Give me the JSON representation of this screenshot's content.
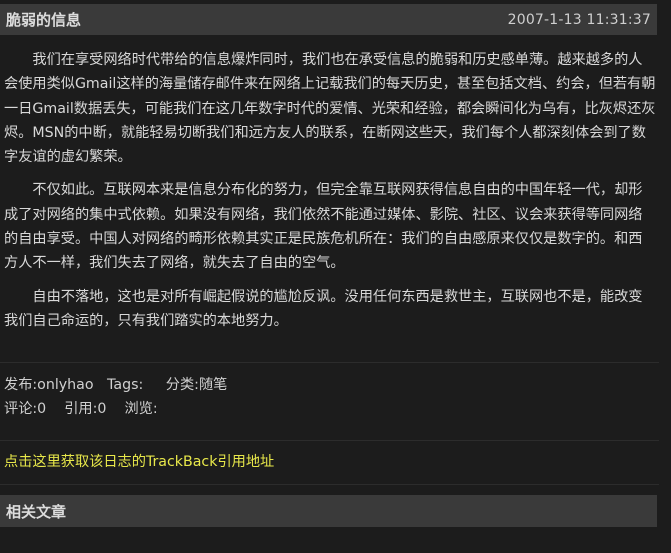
{
  "post": {
    "title": "脆弱的信息",
    "date": "2007-1-13 11:31:37",
    "paragraphs": [
      "　　我们在享受网络时代带给的信息爆炸同时，我们也在承受信息的脆弱和历史感单薄。越来越多的人会使用类似Gmail这样的海量储存邮件来在网络上记载我们的每天历史，甚至包括文档、约会，但若有朝一日Gmail数据丢失，可能我们在这几年数字时代的爱情、光荣和经验，都会瞬间化为乌有，比灰烬还灰烬。MSN的中断，就能轻易切断我们和远方友人的联系，在断网这些天，我们每个人都深刻体会到了数字友谊的虚幻繁荣。",
      "　　不仅如此。互联网本来是信息分布化的努力，但完全靠互联网获得信息自由的中国年轻一代，却形成了对网络的集中式依赖。如果没有网络，我们依然不能通过媒体、影院、社区、议会来获得等同网络的自由享受。中国人对网络的畸形依赖其实正是民族危机所在：我们的自由感原来仅仅是数字的。和西方人不一样，我们失去了网络，就失去了自由的空气。",
      "　　自由不落地，这也是对所有崛起假说的尴尬反讽。没用任何东西是救世主，互联网也不是，能改变我们自己命运的，只有我们踏实的本地努力。"
    ]
  },
  "meta": {
    "line1": "发布:onlyhao   Tags:     分类:随笔",
    "line2": "评论:0    引用:0    浏览:"
  },
  "trackback_label": "点击这里获取该日志的TrackBack引用地址",
  "related_title": "相关文章"
}
